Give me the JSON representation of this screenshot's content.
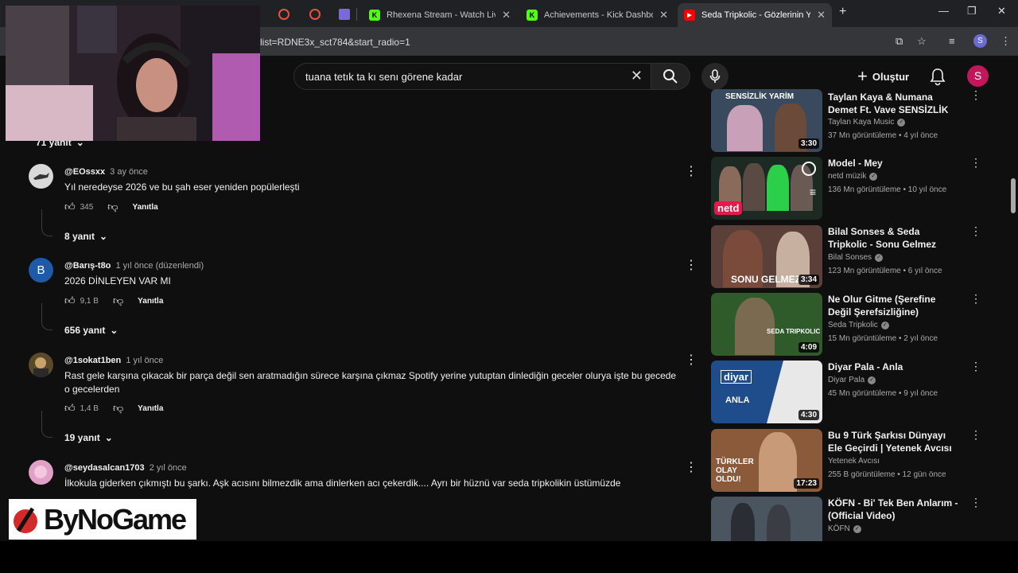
{
  "browser": {
    "tabs": [
      {
        "title": "Rhexena Stream - Watch Live o",
        "favicon": "kick"
      },
      {
        "title": "Achievements - Kick Dashboard",
        "favicon": "kick"
      },
      {
        "title": "Seda Tripkolic - Gözlerinin Yeşil",
        "favicon": "youtube",
        "active": true
      }
    ],
    "url": "list=RDNE3x_sct784&start_radio=1",
    "profile_initial": "S"
  },
  "header": {
    "search_query": "tuana tetık ta kı senı görene kadar",
    "create_label": "Oluştur",
    "avatar_initial": "S"
  },
  "comments": [
    {
      "replies_label": "71 yanıt"
    },
    {
      "user": "@EOssxx",
      "time": "3 ay önce",
      "text": "Yıl neredeyse 2026 ve bu şah eser yeniden popülerleşti",
      "likes": "345",
      "reply_label": "Yanıtla",
      "replies_label": "8 yanıt"
    },
    {
      "user": "@Barış-t8o",
      "time": "1 yıl önce (düzenlendi)",
      "avatar_letter": "B",
      "text": "2026 DİNLEYEN VAR MI",
      "likes": "9,1 B",
      "reply_label": "Yanıtla",
      "replies_label": "656 yanıt"
    },
    {
      "user": "@1sokat1ben",
      "time": "1 yıl önce",
      "text": "Rast gele karşına çıkacak bir parça değil sen aratmadığın sürece karşına çıkmaz Spotify yerine yutuptan dinlediğin geceler olurya işte bu gecede o gecelerden",
      "likes": "1,4 B",
      "reply_label": "Yanıtla",
      "replies_label": "19 yanıt"
    },
    {
      "user": "@seydasalcan1703",
      "time": "2 yıl önce",
      "text": "İlkokula giderken çıkmıştı bu şarkı. Aşk acısını bilmezdik ama dinlerken acı çekerdik.... Ayrı bir hüznü var seda tripkolikin üstümüzde"
    }
  ],
  "sidebar": {
    "videos": [
      {
        "title": "Taylan Kaya & Numana Demet Ft. Vave   SENSİZLİK YARİM [ ...",
        "channel": "Taylan Kaya Music",
        "meta": "37 Mn görüntüleme • 4 yıl önce",
        "duration": "3:30",
        "thumb_text": "SENSİZLİK YARİM",
        "thumb_color": "#3a4a5e"
      },
      {
        "title": "Model - Mey",
        "channel": "netd müzik",
        "meta": "136 Mn görüntüleme • 10 yıl önce",
        "duration": "",
        "thumb_text": "netd",
        "thumb_color": "#1d2a24"
      },
      {
        "title": "Bilal Sonses & Seda Tripkolic - Sonu Gelmez",
        "channel": "Bilal Sonses",
        "meta": "123 Mn görüntüleme • 6 yıl önce",
        "duration": "3:34",
        "thumb_text": "SONU GELMEZ",
        "thumb_color": "#5a4038"
      },
      {
        "title": "Ne Olur Gitme (Şerefine Değil Şerefsizliğine)",
        "channel": "Seda Tripkolic",
        "meta": "15 Mn görüntüleme • 2 yıl önce",
        "duration": "4:09",
        "thumb_text": "SEDA TRIPKOLIC",
        "thumb_color": "#2f5a2a"
      },
      {
        "title": "Diyar Pala - Anla",
        "channel": "Diyar Pala",
        "meta": "45 Mn görüntüleme • 9 yıl önce",
        "duration": "4:30",
        "thumb_text": "ANLA",
        "thumb_color": "#1f4c8a"
      },
      {
        "title": "Bu 9 Türk Şarkısı Dünyayı Ele Geçirdi | Yetenek Avcısı",
        "channel": "Yetenek Avcısı",
        "meta": "255 B görüntüleme • 12 gün önce",
        "duration": "17:23",
        "thumb_text": "TÜRKLER OLAY OLDU!",
        "thumb_color": "#8a5a3a"
      },
      {
        "title": "KÖFN - Bi' Tek Ben Anlarım - (Official Video)",
        "channel": "KÖFN",
        "meta": "",
        "duration": "",
        "thumb_text": "",
        "thumb_color": "#4a5560"
      }
    ]
  },
  "overlay": {
    "logo_text": "ByNoGame"
  }
}
